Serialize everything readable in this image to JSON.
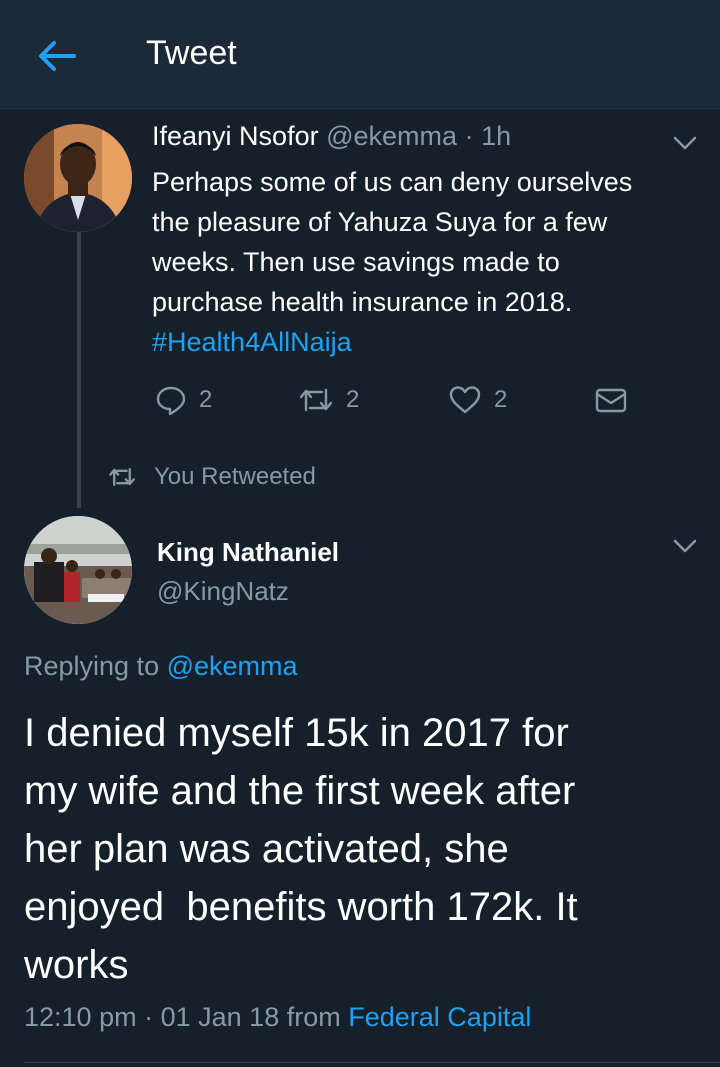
{
  "header": {
    "title": "Tweet",
    "back_icon": "arrow-left-icon"
  },
  "colors": {
    "background": "#15202b",
    "header_bg": "#1c2938",
    "accent": "#1da1f2",
    "muted": "#8899a6"
  },
  "parent_tweet": {
    "author_name": "Ifeanyi Nsofor",
    "handle": "@ekemma",
    "separator": "·",
    "time": "1h",
    "text_lines": [
      "Perhaps some of us can deny ourselves",
      "the pleasure of Yahuza Suya for a few",
      "weeks. Then use savings made to",
      "purchase health insurance in 2018."
    ],
    "hashtag": "#Health4AllNaija",
    "actions": {
      "reply_count": "2",
      "retweet_count": "2",
      "like_count": "2"
    }
  },
  "retweet_indicator": {
    "label": "You Retweeted"
  },
  "main_tweet": {
    "author_name": "King Nathaniel",
    "handle": "@KingNatz",
    "replying_prefix": "Replying to",
    "replying_to": "@ekemma",
    "text_lines": [
      "I denied myself 15k in 2017 for",
      "my wife and the first week after",
      "her plan was activated, she",
      "enjoyed  benefits worth 172k. It",
      "works"
    ],
    "time": "12:10 pm",
    "separator": "·",
    "date": "01 Jan 18",
    "from_label": "from",
    "location": "Federal Capital"
  }
}
